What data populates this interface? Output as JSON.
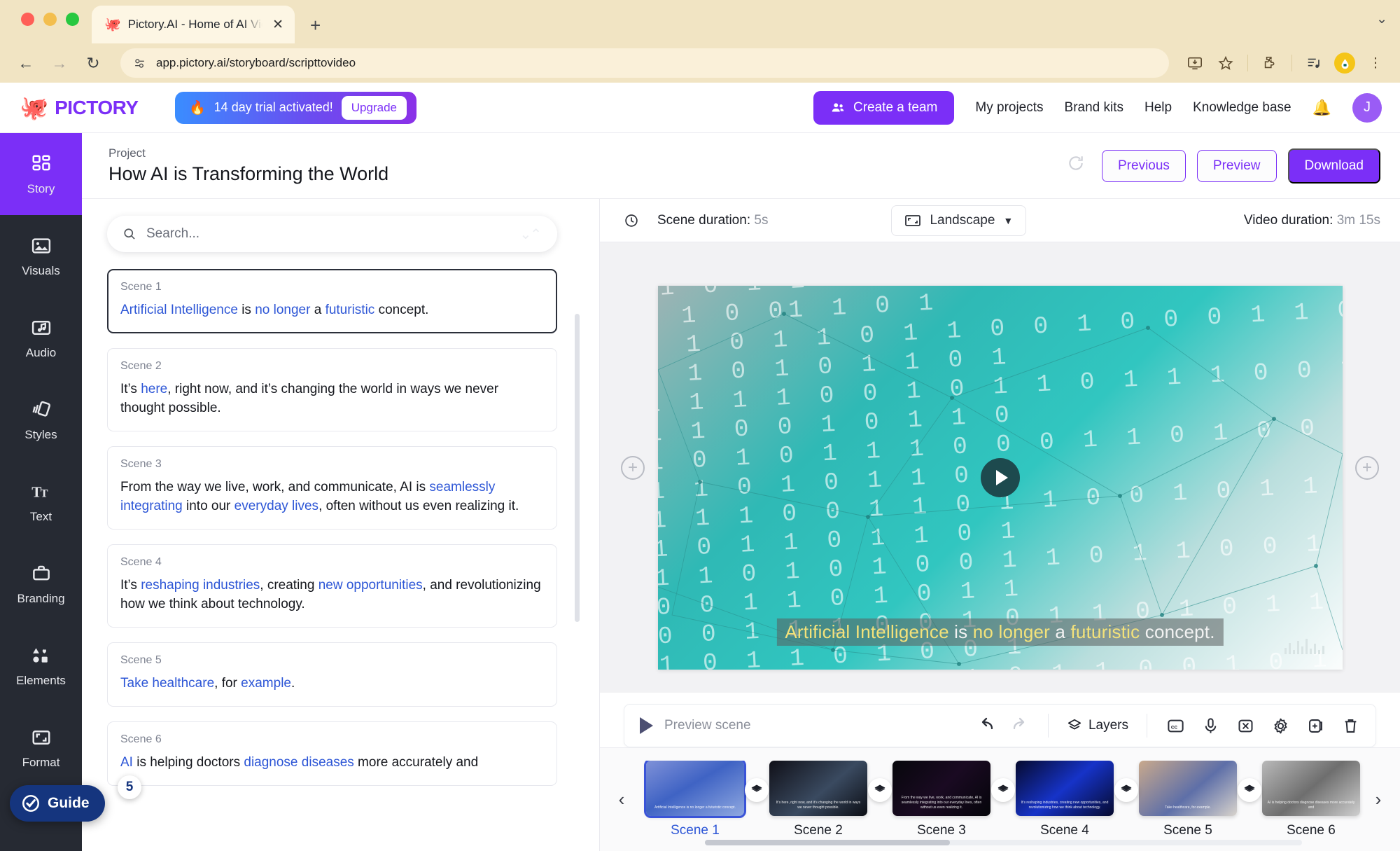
{
  "browser": {
    "tab_title": "Pictory.AI - Home of AI Video",
    "tab_favicon": "octopus-icon",
    "new_tab_label": "+",
    "close_label": "✕",
    "back_label": "←",
    "forward_label": "→",
    "reload_label": "↻",
    "url": "app.pictory.ai/storyboard/scripttovideo",
    "collapse_label": "⌄"
  },
  "header": {
    "logo_text": "PICTORY",
    "trial_text": "14 day trial activated!",
    "upgrade_label": "Upgrade",
    "create_team_label": "Create a team",
    "nav": [
      "My projects",
      "Brand kits",
      "Help",
      "Knowledge base"
    ],
    "avatar_initial": "J"
  },
  "sidebar": {
    "items": [
      {
        "label": "Story",
        "icon": "grid-icon",
        "active": true
      },
      {
        "label": "Visuals",
        "icon": "image-icon",
        "active": false
      },
      {
        "label": "Audio",
        "icon": "music-icon",
        "active": false
      },
      {
        "label": "Styles",
        "icon": "cards-icon",
        "active": false
      },
      {
        "label": "Text",
        "icon": "text-icon",
        "active": false
      },
      {
        "label": "Branding",
        "icon": "briefcase-icon",
        "active": false
      },
      {
        "label": "Elements",
        "icon": "shapes-icon",
        "active": false
      },
      {
        "label": "Format",
        "icon": "resize-icon",
        "active": false
      }
    ],
    "guide_label": "Guide",
    "guide_badge": "5"
  },
  "project": {
    "breadcrumb": "Project",
    "title": "How AI is Transforming the World",
    "previous_label": "Previous",
    "preview_label": "Preview",
    "download_label": "Download"
  },
  "script": {
    "search_placeholder": "Search...",
    "scenes": [
      {
        "tag": "Scene 1",
        "selected": true,
        "parts": [
          {
            "t": "Artificial Intelligence",
            "kw": true
          },
          {
            "t": " is ",
            "kw": false
          },
          {
            "t": "no longer",
            "kw": true
          },
          {
            "t": " a ",
            "kw": false
          },
          {
            "t": "futuristic",
            "kw": true
          },
          {
            "t": " concept.",
            "kw": false
          }
        ]
      },
      {
        "tag": "Scene 2",
        "selected": false,
        "parts": [
          {
            "t": "It’s ",
            "kw": false
          },
          {
            "t": "here",
            "kw": true
          },
          {
            "t": ", right now, and it’s changing the world in ways we never thought possible.",
            "kw": false
          }
        ]
      },
      {
        "tag": "Scene 3",
        "selected": false,
        "parts": [
          {
            "t": "From the way we live, work, and communicate, AI is ",
            "kw": false
          },
          {
            "t": "seamlessly integrating",
            "kw": true
          },
          {
            "t": " into our ",
            "kw": false
          },
          {
            "t": "everyday lives",
            "kw": true
          },
          {
            "t": ", often without us even realizing it.",
            "kw": false
          }
        ]
      },
      {
        "tag": "Scene 4",
        "selected": false,
        "parts": [
          {
            "t": "It’s ",
            "kw": false
          },
          {
            "t": "reshaping industries",
            "kw": true
          },
          {
            "t": ", creating ",
            "kw": false
          },
          {
            "t": "new opportunities",
            "kw": true
          },
          {
            "t": ", and revolutionizing how we think about technology.",
            "kw": false
          }
        ]
      },
      {
        "tag": "Scene 5",
        "selected": false,
        "parts": [
          {
            "t": "Take healthcare",
            "kw": true
          },
          {
            "t": ", for ",
            "kw": false
          },
          {
            "t": "example",
            "kw": true
          },
          {
            "t": ".",
            "kw": false
          }
        ]
      },
      {
        "tag": "Scene 6",
        "selected": false,
        "parts": [
          {
            "t": "AI",
            "kw": true
          },
          {
            "t": " is helping doctors ",
            "kw": false
          },
          {
            "t": "diagnose diseases",
            "kw": true
          },
          {
            "t": " more accurately and",
            "kw": false
          }
        ]
      }
    ]
  },
  "preview": {
    "scene_duration_label": "Scene duration:",
    "scene_duration_value": "5s",
    "ratio_label": "Landscape",
    "ratio_caret": "▼",
    "video_duration_label": "Video duration:",
    "video_duration_value": "3m 15s",
    "caption_parts": [
      {
        "t": "Artificial Intelligence",
        "hi": true
      },
      {
        "t": " is ",
        "hi": false
      },
      {
        "t": "no longer",
        "hi": true
      },
      {
        "t": " a ",
        "hi": false
      },
      {
        "t": "futuristic",
        "hi": true
      },
      {
        "t": " concept.",
        "hi": false
      }
    ],
    "add_scene_left": "+",
    "add_scene_right": "+"
  },
  "controls": {
    "preview_scene_label": "Preview scene",
    "undo_label": "undo-icon",
    "redo_label": "redo-icon",
    "layers_label": "Layers",
    "icons": [
      "closed-caption-icon",
      "microphone-icon",
      "scissors-icon",
      "gear-icon",
      "duplicate-icon",
      "trash-icon"
    ]
  },
  "timeline": {
    "prev_arrow": "‹",
    "next_arrow": "›",
    "scenes": [
      {
        "label": "Scene 1",
        "active": true,
        "caption": "Artificial Intelligence is no longer a futuristic concept."
      },
      {
        "label": "Scene 2",
        "active": false,
        "caption": "It’s here, right now, and it’s changing the world in ways we never thought possible."
      },
      {
        "label": "Scene 3",
        "active": false,
        "caption": "From the way we live, work, and communicate, AI is seamlessly integrating into our everyday lives, often without us even realizing it."
      },
      {
        "label": "Scene 4",
        "active": false,
        "caption": "It’s reshaping industries, creating new opportunities, and revolutionizing how we think about technology."
      },
      {
        "label": "Scene 5",
        "active": false,
        "caption": "Take healthcare, for example."
      },
      {
        "label": "Scene 6",
        "active": false,
        "caption": "AI is helping doctors diagnose diseases more accurately and"
      }
    ]
  },
  "colors": {
    "brand_purple": "#7b2ff7",
    "keyword_blue": "#2d56d6",
    "guide_navy": "#15357e",
    "rail_dark": "#262a33",
    "caption_highlight": "#f3e27a"
  }
}
